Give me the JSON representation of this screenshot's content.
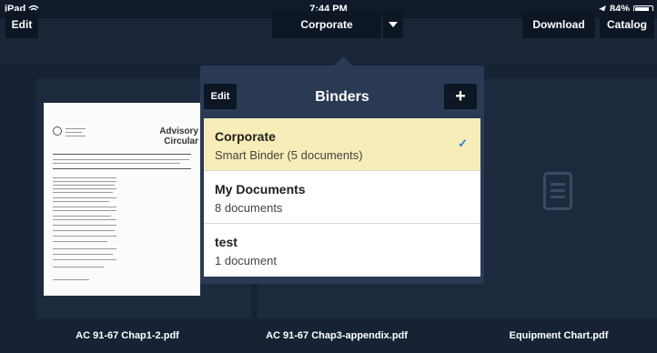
{
  "status_bar": {
    "device": "iPad",
    "wifi_icon": "wifi-icon",
    "time": "7:44 PM",
    "location_icon": "location-arrow-icon",
    "battery_percent": "84%",
    "battery_level": 0.84
  },
  "toolbar": {
    "edit_label": "Edit",
    "binder_selector_label": "Corporate",
    "dropdown_icon": "chevron-down-icon",
    "download_label": "Download",
    "catalog_label": "Catalog"
  },
  "documents": [
    {
      "name": "AC 91-67 Chap1-2.pdf",
      "thumb_title": "Advisory Circular"
    },
    {
      "name": "AC 91-67 Chap3-appendix.pdf"
    },
    {
      "name": "Equipment Chart.pdf",
      "icon": "document-icon"
    }
  ],
  "binders_popover": {
    "edit_label": "Edit",
    "title": "Binders",
    "add_label": "+",
    "items": [
      {
        "name": "Corporate",
        "subtitle": "Smart Binder (5 documents)",
        "selected": true,
        "check": "✓"
      },
      {
        "name": "My Documents",
        "subtitle": "8 documents",
        "selected": false
      },
      {
        "name": "test",
        "subtitle": "1 document",
        "selected": false
      }
    ]
  },
  "colors": {
    "background": "#172334",
    "popover": "#2a3a54",
    "selected_row": "#f7edb8",
    "check": "#2a7de1"
  }
}
